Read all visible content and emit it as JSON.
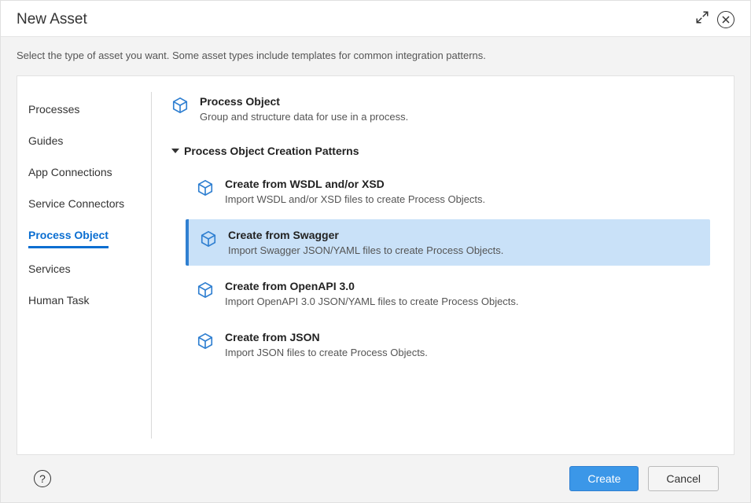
{
  "header": {
    "title": "New Asset"
  },
  "subheader": "Select the type of asset you want. Some asset types include templates for common integration patterns.",
  "sidebar": {
    "items": [
      {
        "label": "Processes",
        "selected": false
      },
      {
        "label": "Guides",
        "selected": false
      },
      {
        "label": "App Connections",
        "selected": false
      },
      {
        "label": "Service Connectors",
        "selected": false
      },
      {
        "label": "Process Object",
        "selected": true
      },
      {
        "label": "Services",
        "selected": false
      },
      {
        "label": "Human Task",
        "selected": false
      }
    ]
  },
  "main": {
    "asset_type": {
      "title": "Process Object",
      "desc": "Group and structure data for use in a process."
    },
    "section_label": "Process Object Creation Patterns",
    "patterns": [
      {
        "title": "Create from WSDL and/or XSD",
        "desc": "Import WSDL and/or XSD files to create Process Objects.",
        "selected": false
      },
      {
        "title": "Create from Swagger",
        "desc": "Import Swagger JSON/YAML files to create Process Objects.",
        "selected": true
      },
      {
        "title": "Create from OpenAPI 3.0",
        "desc": "Import OpenAPI 3.0 JSON/YAML files to create Process Objects.",
        "selected": false
      },
      {
        "title": "Create from JSON",
        "desc": "Import JSON files to create Process Objects.",
        "selected": false
      }
    ]
  },
  "footer": {
    "help": "?",
    "create_label": "Create",
    "cancel_label": "Cancel"
  },
  "colors": {
    "accent": "#3b97e8",
    "selection_bg": "#c9e1f8",
    "selection_border": "#2f7fd1"
  }
}
